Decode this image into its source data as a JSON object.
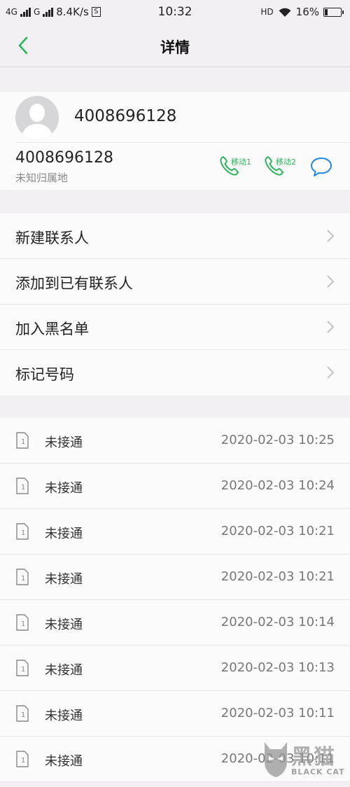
{
  "status_bar": {
    "network1": "4G",
    "network2": "G",
    "speed": "8.4K/s",
    "s_icon": "S",
    "time": "10:32",
    "hd": "HD",
    "battery": "16%",
    "battery_level": 0.16
  },
  "header": {
    "back_icon": "chevron-left-icon",
    "title": "详情"
  },
  "contact": {
    "name": "4008696128",
    "number": "4008696128",
    "location": "未知归属地",
    "call_sim1_label": "移动1",
    "call_sim2_label": "移动2",
    "message_icon": "chat-bubble-icon"
  },
  "menu": {
    "items": [
      {
        "label": "新建联系人"
      },
      {
        "label": "添加到已有联系人"
      },
      {
        "label": "加入黑名单"
      },
      {
        "label": "标记号码"
      }
    ]
  },
  "call_log": [
    {
      "sim": "1",
      "status": "未接通",
      "time": "2020-02-03 10:25"
    },
    {
      "sim": "1",
      "status": "未接通",
      "time": "2020-02-03 10:24"
    },
    {
      "sim": "1",
      "status": "未接通",
      "time": "2020-02-03 10:21"
    },
    {
      "sim": "1",
      "status": "未接通",
      "time": "2020-02-03 10:21"
    },
    {
      "sim": "1",
      "status": "未接通",
      "time": "2020-02-03 10:14"
    },
    {
      "sim": "1",
      "status": "未接通",
      "time": "2020-02-03 10:13"
    },
    {
      "sim": "1",
      "status": "未接通",
      "time": "2020-02-03 10:11"
    },
    {
      "sim": "1",
      "status": "未接通",
      "time": "2020-02-03 10:11"
    }
  ],
  "watermark": {
    "text": "黑猫",
    "sub": "BLACK CAT"
  },
  "colors": {
    "accent": "#2bb55a",
    "background": "#f2f0f2",
    "card": "#fcfbfc"
  }
}
